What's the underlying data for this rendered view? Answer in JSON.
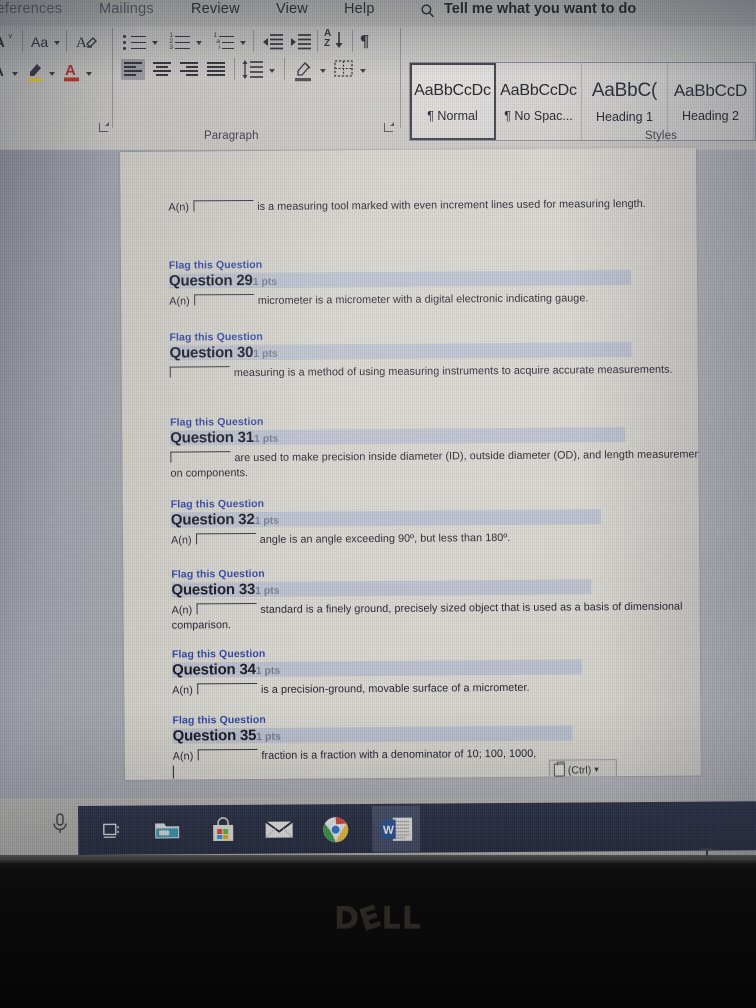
{
  "app": {
    "name": "Microsoft Word",
    "ribbon": {
      "tabs": [
        {
          "label": "References",
          "active": false
        },
        {
          "label": "Mailings",
          "active": false
        },
        {
          "label": "Review",
          "active": false
        },
        {
          "label": "View",
          "active": false
        },
        {
          "label": "Help",
          "active": false
        }
      ],
      "tell_me": "Tell me what you want to do",
      "tell_me_icon": "search-icon",
      "groups": [
        {
          "name": "Font",
          "label": ""
        },
        {
          "name": "Paragraph",
          "label": "Paragraph"
        },
        {
          "name": "Styles",
          "label": "Styles"
        }
      ],
      "font_group": {
        "shrink_font": "A",
        "change_case": "Aa",
        "clear_formatting": "clear-formatting-icon",
        "text_effects": "text-effects-icon",
        "highlight_color": "#f2d534",
        "font_color": "#c5321f"
      },
      "paragraph_group": {
        "label": "Paragraph",
        "buttons": [
          "bullets-icon",
          "numbering-icon",
          "multilevel-list-icon",
          "decrease-indent-icon",
          "increase-indent-icon",
          "sort-icon",
          "show-formatting-marks-icon",
          "align-left-icon",
          "align-center-icon",
          "align-right-icon",
          "justify-icon",
          "line-spacing-icon",
          "shading-icon",
          "borders-icon"
        ],
        "active_alignment": "align-left-icon",
        "sort_label": "AZ"
      },
      "styles_group": {
        "label": "Styles",
        "items": [
          {
            "preview": "AaBbCcDc",
            "name": "¶ Normal",
            "selected": true
          },
          {
            "preview": "AaBbCcDc",
            "name": "¶ No Spac...",
            "selected": false
          },
          {
            "preview": "AaBbC(",
            "name": "Heading 1",
            "selected": false
          },
          {
            "preview": "AaBbCcD",
            "name": "Heading 2",
            "selected": false
          }
        ]
      }
    }
  },
  "document": {
    "blocks": [
      {
        "id": "q28-tail",
        "flag": null,
        "heading": null,
        "points": null,
        "lead_in": "A(n)",
        "blank": true,
        "text": "is a measuring tool marked with even increment lines used for measuring length."
      },
      {
        "id": "q29",
        "flag": "Flag this Question",
        "heading": "Question 29",
        "points": "1 pts",
        "lead_in": "A(n)",
        "blank": true,
        "text": "micrometer is a micrometer with a digital electronic indicating gauge."
      },
      {
        "id": "q30",
        "flag": "Flag this Question",
        "heading": "Question 30",
        "points": "1 pts",
        "lead_in": "",
        "blank": true,
        "text": "measuring is a method of using measuring instruments to acquire accurate measurements."
      },
      {
        "id": "q31",
        "flag": "Flag this Question",
        "heading": "Question 31",
        "points": "1 pts",
        "lead_in": "",
        "blank": true,
        "text": "are used to make precision inside diameter (ID), outside diameter (OD), and length measurements on components."
      },
      {
        "id": "q32",
        "flag": "Flag this Question",
        "heading": "Question 32",
        "points": "1 pts",
        "lead_in": "A(n)",
        "blank": true,
        "text": "angle is an angle exceeding 90º, but less than 180º."
      },
      {
        "id": "q33",
        "flag": "Flag this Question",
        "heading": "Question 33",
        "points": "1 pts",
        "lead_in": "A(n)",
        "blank": true,
        "text": "standard is a finely ground, precisely sized object that is used as a basis of dimensional comparison."
      },
      {
        "id": "q34",
        "flag": "Flag this Question",
        "heading": "Question 34",
        "points": "1 pts",
        "lead_in": "A(n)",
        "blank": true,
        "text": "is a precision-ground, movable surface of a micrometer."
      },
      {
        "id": "q35",
        "flag": "Flag this Question",
        "heading": "Question 35",
        "points": "1 pts",
        "lead_in": "A(n)",
        "blank": true,
        "text": "fraction is a fraction with a denominator of 10; 100, 1000,"
      }
    ],
    "paste_options": {
      "label": "(Ctrl)",
      "icon": "paste-clipboard-icon",
      "caret": "▾"
    }
  },
  "taskbar": {
    "items": [
      {
        "name": "cortana-microphone-icon",
        "label": "Cortana"
      },
      {
        "name": "task-view-icon",
        "label": "Task View"
      },
      {
        "name": "file-explorer-icon",
        "label": "File Explorer"
      },
      {
        "name": "microsoft-store-icon",
        "label": "Microsoft Store"
      },
      {
        "name": "mail-icon",
        "label": "Mail"
      },
      {
        "name": "chrome-icon",
        "label": "Google Chrome"
      },
      {
        "name": "word-icon",
        "label": "Word",
        "active": true
      }
    ]
  },
  "hardware": {
    "brand": "DELL",
    "brand_letters": [
      "D",
      "E",
      "L",
      "L"
    ]
  },
  "cursor": {
    "type": "text-ibeam"
  }
}
